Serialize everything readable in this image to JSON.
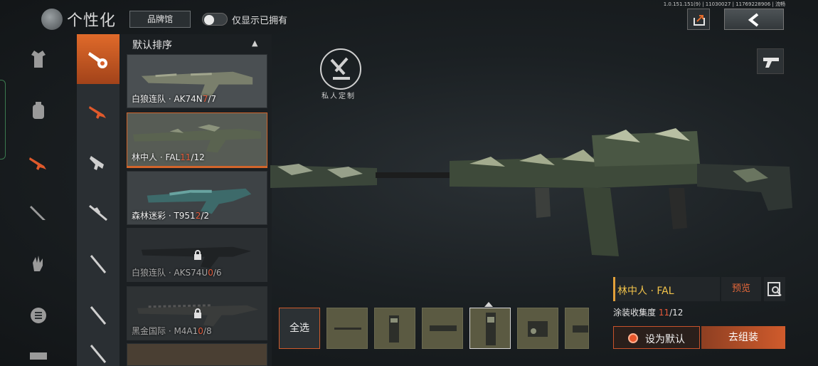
{
  "header": {
    "page_title": "个性化",
    "brand_button": "品牌馆",
    "owned_only_label": "仅显示已拥有",
    "owned_only_on": false,
    "version": "1.0.151.151(9) | 11030027 | 11769228906 | 流畅"
  },
  "left_categories": [
    {
      "icon": "outfit-icon",
      "active": false
    },
    {
      "icon": "backpack-icon",
      "active": false
    },
    {
      "icon": "rifle-icon",
      "active": true
    },
    {
      "icon": "knife-icon",
      "active": false
    },
    {
      "icon": "glove-icon",
      "active": false
    },
    {
      "icon": "badge-icon",
      "active": false
    }
  ],
  "sub_categories": [
    {
      "icon": "weapon-custom-icon",
      "active": true
    },
    {
      "icon": "assault-rifle-icon",
      "active": false
    },
    {
      "icon": "smg-icon",
      "active": false
    },
    {
      "icon": "sniper-icon",
      "active": false
    },
    {
      "icon": "dmr-icon",
      "active": false
    },
    {
      "icon": "shotgun-icon",
      "active": false
    }
  ],
  "skin_list": {
    "sort_label": "默认排序",
    "items": [
      {
        "name": "白狼连队 · AK74N",
        "owned": "7",
        "total": "/7",
        "selected": false,
        "locked": false
      },
      {
        "name": "林中人 · FAL",
        "owned": "11",
        "total": "/12",
        "selected": true,
        "locked": false
      },
      {
        "name": "森林迷彩 · T951",
        "owned": "2",
        "total": "/2",
        "selected": false,
        "locked": false
      },
      {
        "name": "白狼连队 · AKS74U",
        "owned": "0",
        "total": "/6",
        "selected": false,
        "locked": true
      },
      {
        "name": "黑金国际 · M4A1",
        "owned": "0",
        "total": "/8",
        "selected": false,
        "locked": true
      }
    ]
  },
  "display": {
    "emblem_label": "私人定制"
  },
  "info": {
    "skin_name": "林中人 · FAL",
    "preview_label": "预览",
    "collection_label": "涂装收集度 ",
    "collection_owned": "11",
    "collection_total": "/12",
    "set_default_label": "设为默认",
    "assemble_label": "去组装"
  },
  "attachments": {
    "select_all_label": "全选",
    "items": [
      "barrel-attachment-icon",
      "grip-attachment-icon",
      "rail-attachment-icon",
      "magazine-attachment-icon",
      "scope-attachment-icon",
      "muzzle-attachment-icon"
    ]
  },
  "colors": {
    "accent_orange": "#d2652b",
    "highlight_red": "#e75a3a",
    "name_gold": "#f2c34a"
  }
}
